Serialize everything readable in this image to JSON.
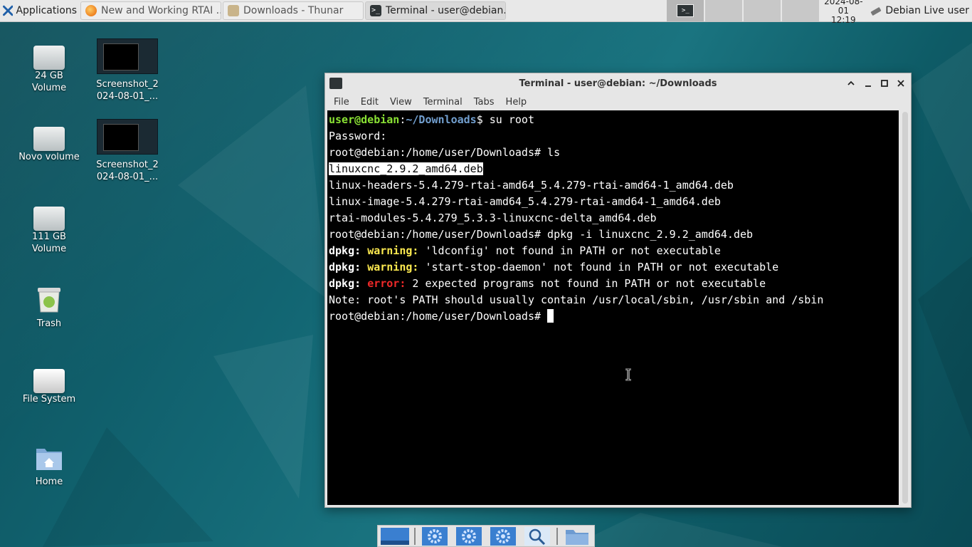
{
  "panel": {
    "apps_label": "Applications",
    "tasks": [
      {
        "label": "New and Working RTAI ...",
        "icon": "firefox-icon"
      },
      {
        "label": "Downloads - Thunar",
        "icon": "folder-icon"
      },
      {
        "label": "Terminal - user@debian...",
        "icon": "terminal-icon"
      }
    ],
    "clock_date": "2024-08-01",
    "clock_time": "12:19",
    "user_label": "Debian Live user"
  },
  "desktop": {
    "icons": [
      {
        "label": "24 GB Volume",
        "icon": "drive-icon"
      },
      {
        "label": "Novo volume",
        "icon": "drive-icon"
      },
      {
        "label": "111 GB Volume",
        "icon": "drive-icon"
      },
      {
        "label": "Trash",
        "icon": "trash-icon"
      },
      {
        "label": "File System",
        "icon": "drive-icon"
      },
      {
        "label": "Home",
        "icon": "home-folder-icon"
      },
      {
        "label": "Screenshot_2024-08-01_...",
        "label_l1": "Screenshot_2",
        "label_l2": "024-08-01_...",
        "icon": "image-icon"
      },
      {
        "label": "Screenshot_2024-08-01_...",
        "label_l1": "Screenshot_2",
        "label_l2": "024-08-01_...",
        "icon": "image-icon"
      }
    ]
  },
  "terminal": {
    "title": "Terminal - user@debian: ~/Downloads",
    "menu": [
      "File",
      "Edit",
      "View",
      "Terminal",
      "Tabs",
      "Help"
    ],
    "lines": {
      "l1_user": "user@debian",
      "l1_colon": ":",
      "l1_path": "~/Downloads",
      "l1_cmd": "$ su root",
      "l2": "Password:",
      "l3": "root@debian:/home/user/Downloads# ls",
      "l4": "linuxcnc_2.9.2_amd64.deb",
      "l5": "linux-headers-5.4.279-rtai-amd64_5.4.279-rtai-amd64-1_amd64.deb",
      "l6": "linux-image-5.4.279-rtai-amd64_5.4.279-rtai-amd64-1_amd64.deb",
      "l7": "rtai-modules-5.4.279_5.3.3-linuxcnc-delta_amd64.deb",
      "l8": "root@debian:/home/user/Downloads# dpkg -i linuxcnc_2.9.2_amd64.deb",
      "dpkg": "dpkg:",
      "warning": "warning:",
      "error": "error:",
      "l9_rest": " 'ldconfig' not found in PATH or not executable",
      "l10_rest": " 'start-stop-daemon' not found in PATH or not executable",
      "l11_rest": " 2 expected programs not found in PATH or not executable",
      "l12": "Note: root's PATH should usually contain /usr/local/sbin, /usr/sbin and /sbin",
      "l13": "root@debian:/home/user/Downloads# "
    }
  },
  "dock": {
    "items": [
      "show-desktop-icon",
      "settings-icon",
      "settings-icon",
      "settings-icon",
      "search-icon",
      "folder-icon"
    ]
  },
  "colors": {
    "prompt_user": "#8ae234",
    "prompt_path": "#729fcf",
    "warning": "#fce94f",
    "error": "#ef2929"
  }
}
